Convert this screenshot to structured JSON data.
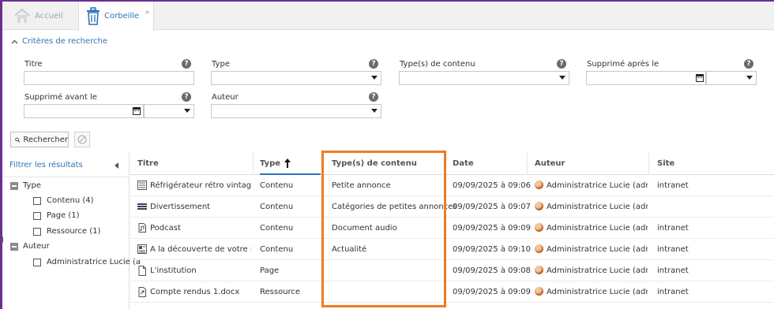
{
  "tabs": [
    {
      "label": "Accueil"
    },
    {
      "label": "Corbeille",
      "close": "×"
    }
  ],
  "criteria": {
    "toggle_label": "Critères de recherche",
    "fields": {
      "title": "Titre",
      "type": "Type",
      "content_types": "Type(s) de contenu",
      "deleted_after": "Supprimé après le",
      "deleted_before": "Supprimé avant le",
      "author": "Auteur"
    },
    "help": "?"
  },
  "buttons": {
    "search": "Rechercher"
  },
  "filters": {
    "title": "Filtrer les résultats",
    "groups": [
      {
        "label": "Type",
        "options": [
          "Contenu (4)",
          "Page (1)",
          "Ressource (1)"
        ]
      },
      {
        "label": "Auteur",
        "options": [
          "Administratrice Lucie (a"
        ]
      }
    ]
  },
  "grid": {
    "columns": [
      "Titre",
      "Type",
      "Type(s) de contenu",
      "Date",
      "Auteur",
      "Site"
    ],
    "sort_indicator": "🠕",
    "rows": [
      {
        "icon": "classified-ad-icon",
        "title": "Réfrigérateur rétro vintage...",
        "type": "Contenu",
        "content_type": "Petite annonce",
        "date": "09/09/2025 à 09:06",
        "author": "Administratrice Lucie (adm...",
        "site": "intranet"
      },
      {
        "icon": "category-list-icon",
        "title": "Divertissement",
        "type": "Contenu",
        "content_type": "Catégories de petites annonces",
        "date": "09/09/2025 à 09:07",
        "author": "Administratrice Lucie (adm...",
        "site": ""
      },
      {
        "icon": "audio-file-icon",
        "title": "Podcast",
        "type": "Contenu",
        "content_type": "Document audio",
        "date": "09/09/2025 à 09:09",
        "author": "Administratrice Lucie (adm...",
        "site": "intranet"
      },
      {
        "icon": "news-icon",
        "title": "A la découverte de votre n...",
        "type": "Contenu",
        "content_type": "Actualité",
        "date": "09/09/2025 à 09:10",
        "author": "Administratrice Lucie (adm...",
        "site": "intranet"
      },
      {
        "icon": "page-icon",
        "title": "L'institution",
        "type": "Page",
        "content_type": "",
        "date": "09/09/2025 à 09:08",
        "author": "Administratrice Lucie (adm...",
        "site": "intranet"
      },
      {
        "icon": "resource-file-icon",
        "title": "Compte rendus 1.docx",
        "type": "Ressource",
        "content_type": "",
        "date": "09/09/2025 à 09:09",
        "author": "Administratrice Lucie (adm...",
        "site": "intranet"
      }
    ]
  },
  "colors": {
    "accent": "#2e74b5",
    "frame": "#6a2f8f",
    "highlight": "#ef7b23"
  }
}
